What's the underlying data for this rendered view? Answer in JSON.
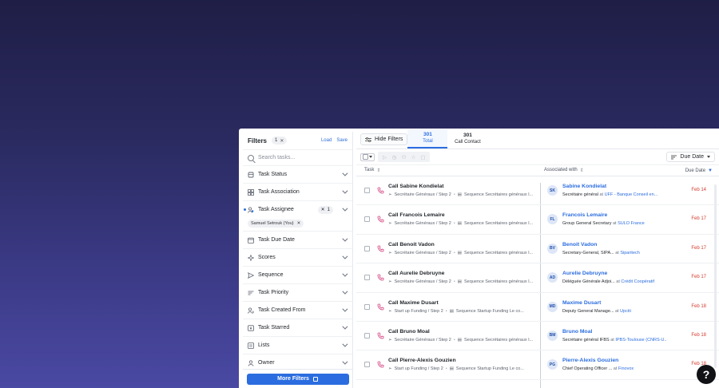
{
  "filters": {
    "title": "Filters",
    "active_count": "1",
    "clear_symbol": "✕",
    "load_label": "Load",
    "save_label": "Save",
    "search_placeholder": "Search tasks...",
    "items": [
      {
        "label": "Task Status",
        "icon": "status-icon"
      },
      {
        "label": "Task Association",
        "icon": "grid-icon"
      },
      {
        "label": "Task Assignee",
        "icon": "users-icon",
        "badge": "1",
        "chip": "Samuel Setrouk (You)"
      },
      {
        "label": "Task Due Date",
        "icon": "calendar-icon"
      },
      {
        "label": "Scores",
        "icon": "sparkle-icon"
      },
      {
        "label": "Sequence",
        "icon": "send-icon"
      },
      {
        "label": "Task Priority",
        "icon": "priority-icon"
      },
      {
        "label": "Task Created From",
        "icon": "source-icon"
      },
      {
        "label": "Task Starred",
        "icon": "star-icon"
      },
      {
        "label": "Lists",
        "icon": "list-icon"
      },
      {
        "label": "Owner",
        "icon": "person-icon"
      }
    ],
    "more_filters_label": "More Filters"
  },
  "main": {
    "hide_filters_label": "Hide Filters",
    "tabs": [
      {
        "count": "301",
        "label": "Total",
        "active": true
      },
      {
        "count": "301",
        "label": "Call Contact",
        "active": false
      }
    ],
    "sort_label": "Due Date",
    "columns": {
      "task": "Task",
      "associated": "Associated with",
      "due": "Due Date"
    },
    "rows": [
      {
        "title": "Call Sabine Kondielat",
        "step": "Secrétaire Généraux / Step 2",
        "sequence": "Sequence Secrétaires généraux I...",
        "initials": "SK",
        "person": "Sabine Kondielat",
        "role": "Secrétaire général",
        "company": "UFF - Banque Conseil en...",
        "due": "Feb 14"
      },
      {
        "title": "Call Francois Lemaire",
        "step": "Secrétaire Généraux / Step 2",
        "sequence": "Sequence Secrétaires généraux I...",
        "initials": "FL",
        "person": "Francois Lemaire",
        "role": "Group General Secretary",
        "company": "SULO France",
        "due": "Feb 17"
      },
      {
        "title": "Call Benoit Vadon",
        "step": "Secrétaire Généraux / Step 2",
        "sequence": "Sequence Secrétaires généraux I...",
        "initials": "BV",
        "person": "Benoit Vadon",
        "role": "Secretary-General, SIPA...",
        "company": "Siparitech",
        "due": "Feb 17"
      },
      {
        "title": "Call Aurelie Debruyne",
        "step": "Secrétaire Généraux / Step 2",
        "sequence": "Sequence Secrétaires généraux I...",
        "initials": "AD",
        "person": "Aurelie Debruyne",
        "role": "Déléguée Générale Adjoi...",
        "company": "Crédit Coopératif",
        "due": "Feb 17"
      },
      {
        "title": "Call Maxime Dusart",
        "step": "Start up Funding / Step 2",
        "sequence": "Sequence Startup Funding Le co...",
        "initials": "MD",
        "person": "Maxime Dusart",
        "role": "Deputy General Manage...",
        "company": "Upciti",
        "due": "Feb 18"
      },
      {
        "title": "Call Bruno Moal",
        "step": "Secrétaire Généraux / Step 2",
        "sequence": "Sequence Secrétaires généraux I...",
        "initials": "BM",
        "person": "Bruno Moal",
        "role": "Secrétaire général IFBS",
        "company": "IPBS-Toulouse (CNRS-U...",
        "due": "Feb 18"
      },
      {
        "title": "Call Pierre-Alexis Gouzien",
        "step": "Start up Funding / Step 2",
        "sequence": "Sequence Startup Funding Le co...",
        "initials": "PG",
        "person": "Pierre-Alexis Gouzien",
        "role": "Chief Operating Officer ...",
        "company": "Finovox",
        "due": "Feb 18"
      }
    ],
    "at_word": "at"
  },
  "help_label": "?"
}
